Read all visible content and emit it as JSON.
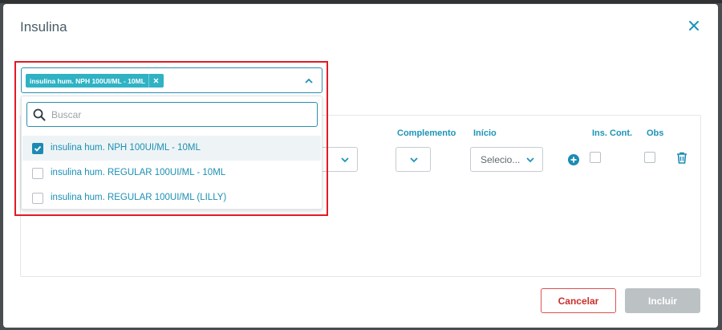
{
  "modal": {
    "title": "Insulina"
  },
  "multiselect": {
    "selected_tag": "insulina hum. NPH 100UI/ML - 10ML",
    "search_placeholder": "Buscar",
    "options": [
      {
        "label": "insulina hum. NPH 100UI/ML - 10ML",
        "checked": true
      },
      {
        "label": "insulina hum. REGULAR 100UI/ML - 10ML",
        "checked": false
      },
      {
        "label": "insulina hum. REGULAR 100UI/ML (LILLY)",
        "checked": false
      }
    ]
  },
  "table": {
    "headers": {
      "complemento": "Complemento",
      "inicio": "Início",
      "ins_cont": "Ins. Cont.",
      "obs": "Obs"
    },
    "inicio_value": "Selecio..."
  },
  "footer": {
    "cancel_label": "Cancelar",
    "include_label": "Incluir"
  },
  "colors": {
    "accent": "#1c94b7",
    "tag": "#2fb2c4",
    "highlight": "#e01b24",
    "cancel": "#c9302c",
    "disabled": "#bcc1c4"
  },
  "icons": [
    "close-icon",
    "chevron-up-icon",
    "chevron-down-icon",
    "search-icon",
    "check-icon",
    "plus-circle-icon",
    "trash-icon"
  ]
}
